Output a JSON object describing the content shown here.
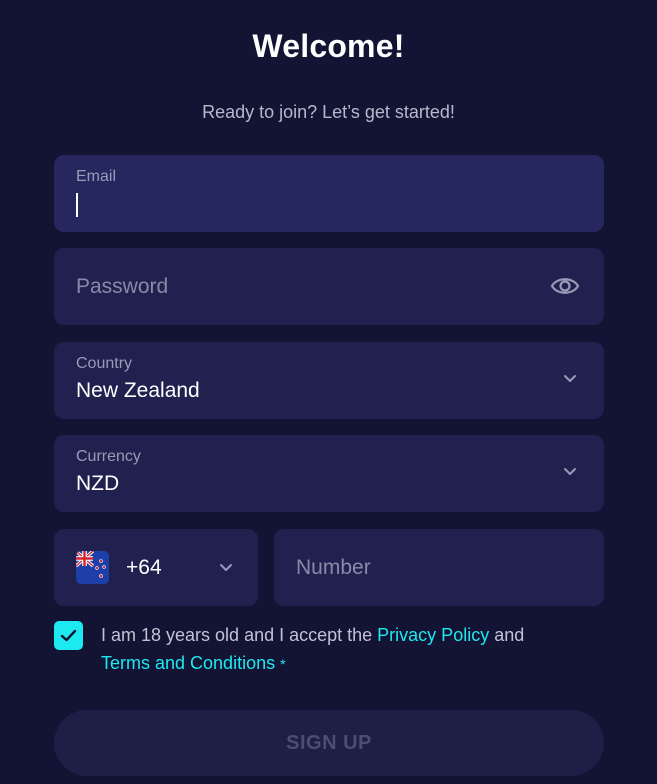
{
  "header": {
    "title": "Welcome!",
    "subtitle": "Ready to join? Let’s get started!"
  },
  "form": {
    "email": {
      "label": "Email",
      "value": ""
    },
    "password": {
      "placeholder": "Password"
    },
    "country": {
      "label": "Country",
      "value": "New Zealand"
    },
    "currency": {
      "label": "Currency",
      "value": "NZD"
    },
    "phone": {
      "code": "+64",
      "placeholder": "Number",
      "flag_icon": "nz-flag-icon"
    },
    "consent": {
      "checked": true,
      "text_before": "I am 18 years old and I accept the ",
      "privacy_link": "Privacy Policy",
      "text_between": " and",
      "terms_link": "Terms and Conditions",
      "required_marker": "*"
    },
    "submit_label": "SIGN UP"
  },
  "colors": {
    "background": "#131334",
    "field_bg": "#212150",
    "accent": "#1de9f0",
    "disabled_button_bg": "#1e1e46"
  }
}
